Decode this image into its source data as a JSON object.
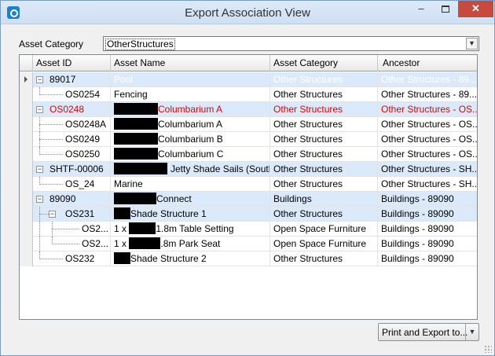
{
  "window": {
    "title": "Export Association View",
    "icon": "app-logo-icon",
    "controls": {
      "minimize": "–",
      "close": "✕"
    }
  },
  "asset_category": {
    "label": "Asset Category",
    "value": "OtherStructures",
    "dropdown_icon": "chevron-down-icon"
  },
  "grid": {
    "columns": [
      "Asset ID",
      "Asset Name",
      "Asset Category",
      "Ancestor"
    ],
    "rows": [
      {
        "level": 0,
        "expander": "−",
        "id": "89017",
        "name": "Pool",
        "category": "Other Structures",
        "ancestor": "Other Structures - 89...",
        "style": "group pale",
        "current": true
      },
      {
        "level": 1,
        "id": "OS0254",
        "name": "Fencing",
        "category": "Other Structures",
        "ancestor": "Other Structures - 89...",
        "style": "white"
      },
      {
        "level": 0,
        "expander": "−",
        "id": "OS0248",
        "name": "Columbarium A",
        "redact_width": 56,
        "category": "Other Structures",
        "ancestor": "Other Structures - OS...",
        "style": "group red"
      },
      {
        "level": 1,
        "id": "OS0248A",
        "name": "Columbarium A",
        "redact_width": 56,
        "category": "Other Structures",
        "ancestor": "Other Structures - OS...",
        "style": "white"
      },
      {
        "level": 1,
        "id": "OS0249",
        "name": "Columbarium B",
        "redact_width": 56,
        "category": "Other Structures",
        "ancestor": "Other Structures - OS...",
        "style": "white"
      },
      {
        "level": 1,
        "id": "OS0250",
        "name": "Columbarium C",
        "redact_width": 56,
        "category": "Other Structures",
        "ancestor": "Other Structures - OS...",
        "style": "white"
      },
      {
        "level": 0,
        "expander": "−",
        "id": "SHTF-00006",
        "name": "Jetty Shade Sails (South)",
        "redact_width": 68,
        "category": "Other Structures",
        "ancestor": "Other Structures - SH...",
        "style": "group"
      },
      {
        "level": 1,
        "id": "OS_24",
        "name": "Marine",
        "category": "Other Structures",
        "ancestor": "Other Structures - SH...",
        "style": "white"
      },
      {
        "level": 0,
        "expander": "−",
        "id": "89090",
        "name": "Connect",
        "redact_width": 54,
        "category": "Buildings",
        "ancestor": "Buildings - 89090",
        "style": "group"
      },
      {
        "level": 1,
        "expander": "−",
        "id": "OS231",
        "name": "Shade Structure 1",
        "redact_width": 21,
        "category": "Other Structures",
        "ancestor": "Buildings - 89090",
        "style": "group"
      },
      {
        "level": 2,
        "id": "OS2...",
        "name_prefix": "1 x",
        "name": "1.8m Table Setting",
        "redact_width": 34,
        "category": "Open Space Furniture",
        "ancestor": "Buildings - 89090",
        "style": "white"
      },
      {
        "level": 2,
        "id": "OS2...",
        "name_prefix": "1 x",
        "name": ".8m Park Seat",
        "redact_width": 40,
        "category": "Open Space Furniture",
        "ancestor": "Buildings - 89090",
        "style": "white"
      },
      {
        "level": 1,
        "id": "OS232",
        "name": "Shade Structure 2",
        "redact_width": 21,
        "category": "Other Structures",
        "ancestor": "Buildings - 89090",
        "style": "white",
        "last": true
      }
    ]
  },
  "footer": {
    "print_export_label": "Print and Export to...",
    "arrow_icon": "chevron-down-icon"
  }
}
